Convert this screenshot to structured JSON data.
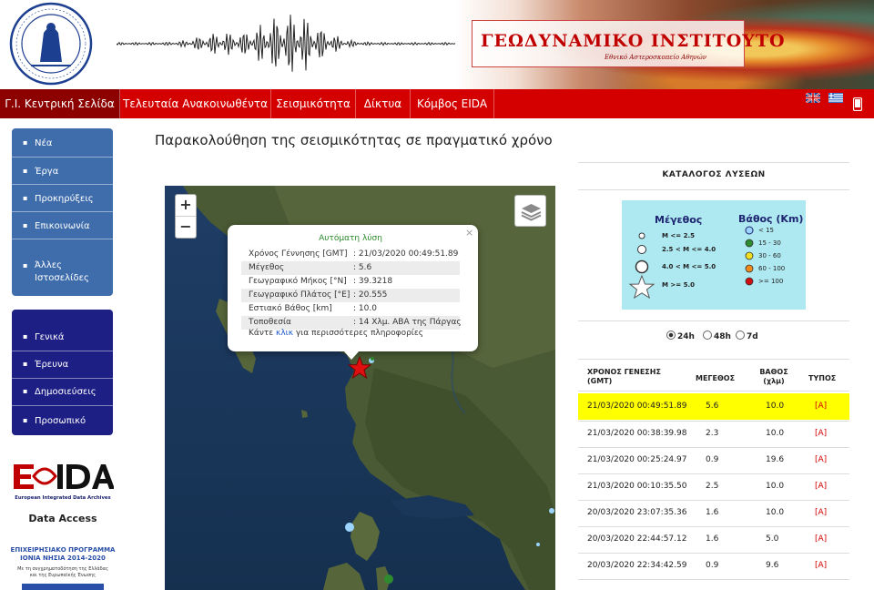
{
  "banner": {
    "title": "ΓΕΩΔΥΝΑΜΙΚΟ ΙΝΣΤΙΤΟΥΤΟ",
    "subtitle": "Εθνικό Αστεροσκοπείο Αθηνών"
  },
  "nav": {
    "items": [
      "Γ.Ι. Κεντρική Σελίδα",
      "Τελευταία Ανακοινωθέντα",
      "Σεισμικότητα",
      "Δίκτυα",
      "Κόμβος EIDA"
    ],
    "active_index": 0
  },
  "sidebar": {
    "group1": [
      "Νέα",
      "Έργα",
      "Προκηρύξεις",
      "Επικοινωνία",
      "Άλλες Ιστοσελίδες"
    ],
    "group2": [
      "Γενικά",
      "Έρευνα",
      "Δημοσιεύσεις",
      "Προσωπικό"
    ],
    "eida_caption": "European Integrated Data Archives",
    "data_access": "Data Access",
    "program_line1": "ΕΠΙΧΕΙΡΗΣΙΑΚΟ ΠΡΟΓΡΑΜΜΑ",
    "program_line2": "ΙΟΝΙΑ ΝΗΣΙΑ 2014-2020",
    "program_small1": "Με τη συγχρηματοδότηση της Ελλάδας",
    "program_small2": "και της Ευρωπαϊκής Ένωσης"
  },
  "page": {
    "title": "Παρακολούθηση της σεισμικότητας σε πραγματικό χρόνο"
  },
  "map": {
    "zoom_in": "+",
    "zoom_out": "−"
  },
  "popup": {
    "header": "Αυτόματη λύση",
    "close": "×",
    "rows": [
      {
        "label": "Χρόνος Γέννησης [GMT]",
        "value": ": 21/03/2020 00:49:51.89"
      },
      {
        "label": "Μέγεθος",
        "value": ": 5.6"
      },
      {
        "label": "Γεωγραφικό Μήκος [°N]",
        "value": ": 39.3218"
      },
      {
        "label": "Γεωγραφικό Πλάτος [°E]",
        "value": ": 20.555"
      },
      {
        "label": "Εστιακό Βάθος [km]",
        "value": ": 10.0"
      },
      {
        "label": "Τοποθεσία",
        "value": ": 14 Χλμ. ΑΒΑ της Πάργας"
      }
    ],
    "more_prefix": "Κάντε ",
    "more_link": "κλικ",
    "more_suffix": " για περισσότερες πληροφορίες"
  },
  "catalog": {
    "title": "ΚΑΤΑΛΟΓΟΣ ΛΥΣΕΩΝ",
    "legend": {
      "magnitude_title": "Μέγεθος",
      "depth_title": "Βάθος (Km)",
      "magnitude_items": [
        "M <= 2.5",
        "2.5 < M <= 4.0",
        "4.0 < M <= 5.0",
        "M >= 5.0"
      ],
      "depth_items": [
        {
          "label": "< 15",
          "color": "#9ad4ff"
        },
        {
          "label": "15 - 30",
          "color": "#2e8b2e"
        },
        {
          "label": "30 - 60",
          "color": "#f0e020"
        },
        {
          "label": "60 - 100",
          "color": "#f08a1a"
        },
        {
          "label": ">= 100",
          "color": "#d01010"
        }
      ]
    },
    "periods": [
      {
        "label": "24h",
        "selected": true
      },
      {
        "label": "48h",
        "selected": false
      },
      {
        "label": "7d",
        "selected": false
      }
    ],
    "columns": {
      "time_line1": "ΧΡΟΝΟΣ ΓΕΝΕΣΗΣ",
      "time_line2": "(GMT)",
      "magnitude": "ΜΕΓΕΘΟΣ",
      "depth_line1": "ΒΑΘΟΣ",
      "depth_line2": "(χλμ)",
      "type": "ΤΥΠΟΣ"
    },
    "rows": [
      {
        "time": "21/03/2020 00:49:51.89",
        "mag": "5.6",
        "depth": "10.0",
        "type": "[A]"
      },
      {
        "time": "21/03/2020 00:38:39.98",
        "mag": "2.3",
        "depth": "10.0",
        "type": "[A]"
      },
      {
        "time": "21/03/2020 00:25:24.97",
        "mag": "0.9",
        "depth": "19.6",
        "type": "[A]"
      },
      {
        "time": "21/03/2020 00:10:35.50",
        "mag": "2.5",
        "depth": "10.0",
        "type": "[A]"
      },
      {
        "time": "20/03/2020 23:07:35.36",
        "mag": "1.6",
        "depth": "10.0",
        "type": "[A]"
      },
      {
        "time": "20/03/2020 22:44:57.12",
        "mag": "1.6",
        "depth": "5.0",
        "type": "[A]"
      },
      {
        "time": "20/03/2020 22:34:42.59",
        "mag": "0.9",
        "depth": "9.6",
        "type": "[A]"
      }
    ]
  },
  "colors": {
    "nav_red": "#d40000",
    "nav_active": "#8c0000",
    "sidebar_blue": "#3f6dac",
    "sidebar_navy": "#1d1f84",
    "highlight_row": "#ffff00",
    "legend_bg": "#aee8f0"
  },
  "icons": {
    "nav_flags": [
      "uk-flag-icon",
      "greek-flag-icon"
    ],
    "mobile": "mobile-phone-icon",
    "map_layers": "layers-icon",
    "event": "red-star-icon"
  }
}
